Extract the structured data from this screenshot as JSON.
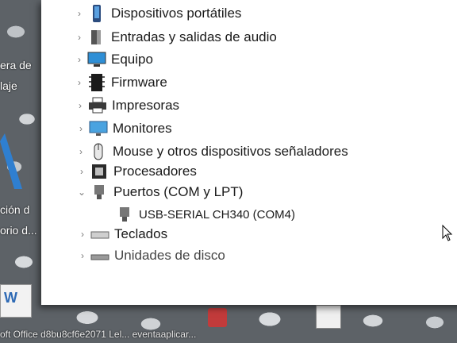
{
  "desktop": {
    "left_fragments": [
      "era de",
      "laje",
      "ción d",
      "orio d..."
    ],
    "taskbar_text": "oft Office  d8bu8cf6e2071   Lel...   eventaaplicar..."
  },
  "device_manager": {
    "categories": [
      {
        "label": "Dispositivos portátiles",
        "expanded": false,
        "icon": "portable-device-icon"
      },
      {
        "label": "Entradas y salidas de audio",
        "expanded": false,
        "icon": "speaker-icon"
      },
      {
        "label": "Equipo",
        "expanded": false,
        "icon": "computer-icon"
      },
      {
        "label": "Firmware",
        "expanded": false,
        "icon": "firmware-icon"
      },
      {
        "label": "Impresoras",
        "expanded": false,
        "icon": "printer-icon"
      },
      {
        "label": "Monitores",
        "expanded": false,
        "icon": "monitor-icon"
      },
      {
        "label": "Mouse y otros dispositivos señaladores",
        "expanded": false,
        "icon": "mouse-icon"
      },
      {
        "label": "Procesadores",
        "expanded": false,
        "icon": "processor-icon"
      },
      {
        "label": "Puertos (COM y LPT)",
        "expanded": true,
        "icon": "port-icon",
        "children": [
          {
            "label": "USB-SERIAL CH340 (COM4)",
            "icon": "port-icon"
          }
        ]
      },
      {
        "label": "Teclados",
        "expanded": false,
        "icon": "keyboard-icon"
      },
      {
        "label": "Unidades de disco",
        "expanded": false,
        "icon": "disk-drive-icon"
      }
    ]
  },
  "colors": {
    "window_bg": "#ffffff",
    "text": "#1a1a1a",
    "accent_blue": "#2f8fd6"
  }
}
